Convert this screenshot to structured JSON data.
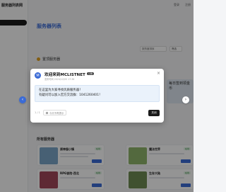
{
  "page": {
    "site_name": "服务器列表网",
    "title": "服务器列表",
    "featured_label": "置顶服务器",
    "sort_value": "按热度排序",
    "filter_label": "筛选",
    "side_card_text": "每日签到领金币",
    "all_servers_label": "所有服务器",
    "topbar": [
      "登录",
      "注册"
    ],
    "servers": [
      {
        "name": "原神服小镇",
        "tag": "在线",
        "thumb": "#7aa5c8"
      },
      {
        "name": "魔法世界",
        "tag": "在线",
        "thumb": "#8fb56b"
      },
      {
        "name": "RPG冒险·西北",
        "tag": "在线",
        "thumb": "#a3485a"
      },
      {
        "name": "生存大陆",
        "tag": "在线",
        "thumb": "#6e8c54"
      }
    ]
  },
  "modal": {
    "logo_letter": "M",
    "title": "欢迎来到MCLISTNET",
    "badge": "公告",
    "date": "发布时间 2024/12/05 17:36",
    "lines": [
      "在这里为大家寻找优质服务器！",
      "有疑问可以加入官方交流群：1041260401！"
    ],
    "pager": "1 / 1",
    "dont_show_label": "今天不再提示",
    "close_label": "关闭"
  },
  "nav": {
    "left_icon": "chevron-left-icon",
    "right_icon": "chevron-right-icon"
  }
}
